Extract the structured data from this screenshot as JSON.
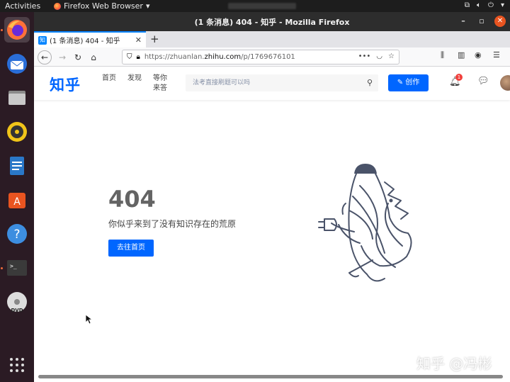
{
  "topbar": {
    "activities": "Activities",
    "app_menu": "Firefox Web Browser"
  },
  "dock": {
    "items": [
      "firefox",
      "thunderbird",
      "files",
      "rhythmbox",
      "libreoffice-writer",
      "software",
      "help",
      "terminal",
      "dvd",
      "show-apps"
    ]
  },
  "window": {
    "title": "(1 条消息) 404 - 知乎 - Mozilla Firefox"
  },
  "tab": {
    "favicon": "知",
    "label": "(1 条消息) 404 - 知乎"
  },
  "navbar": {
    "url_prefix": "https://zhuanlan.",
    "url_domain": "zhihu.com",
    "url_path": "/p/1769676101"
  },
  "zhihu": {
    "logo": "知乎",
    "nav": [
      "首页",
      "发现",
      "等你来答"
    ],
    "search_placeholder": "法考直接刷题可以吗",
    "create_label": "创作",
    "notification_count": "1"
  },
  "error": {
    "code": "404",
    "message": "你似乎来到了没有知识存在的荒原",
    "home_button": "去往首页"
  },
  "watermark": "知乎 @冯彬",
  "colors": {
    "accent": "#0066ff",
    "ubuntu_orange": "#e95420"
  }
}
